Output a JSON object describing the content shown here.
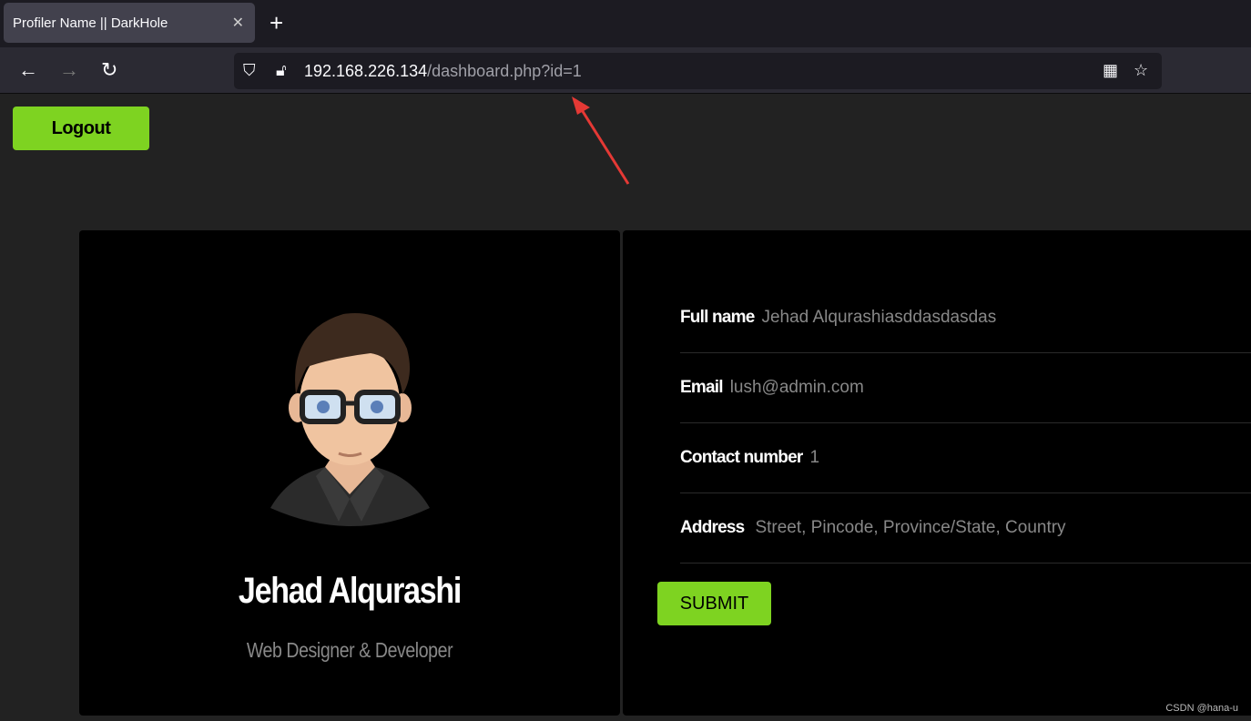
{
  "browser": {
    "tab_title": "Profiler Name || DarkHole",
    "url_host": "192.168.226.134",
    "url_path": "/dashboard.php?id=1"
  },
  "page": {
    "logout_label": "Logout",
    "profile_name": "Jehad Alqurashi",
    "profile_role": "Web Designer & Developer",
    "fields": [
      {
        "label": "Full name",
        "value": "Jehad Alqurashiasddasdasdas"
      },
      {
        "label": "Email",
        "value": "lush@admin.com"
      },
      {
        "label": "Contact number",
        "value": "1"
      },
      {
        "label": "Address",
        "placeholder": "Street, Pincode, Province/State, Country"
      }
    ],
    "submit_label": "SUBMIT"
  },
  "watermark": "CSDN @hana-u",
  "colors": {
    "accent": "#7ed321",
    "annotation_arrow": "#e53935"
  }
}
